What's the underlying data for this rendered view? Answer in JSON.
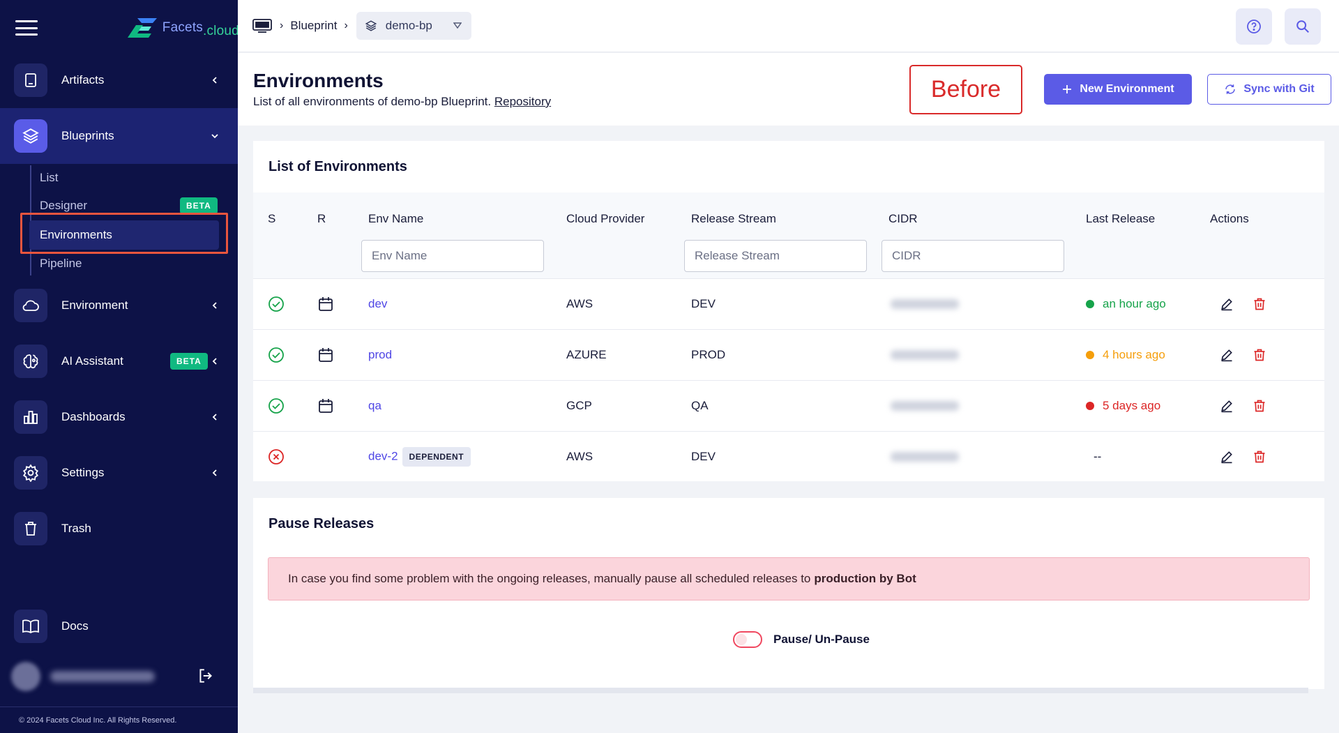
{
  "brand": {
    "name": "Facets",
    "suffix": ".cloud"
  },
  "sidebar": {
    "items": [
      {
        "label": "Artifacts",
        "icon": "book-icon"
      },
      {
        "label": "Blueprints",
        "icon": "layers-icon"
      },
      {
        "label": "Environment",
        "icon": "cloud-icon"
      },
      {
        "label": "AI Assistant",
        "icon": "brain-icon",
        "badge": "BETA"
      },
      {
        "label": "Dashboards",
        "icon": "bar-chart-icon"
      },
      {
        "label": "Settings",
        "icon": "gear-icon"
      },
      {
        "label": "Trash",
        "icon": "trash-icon"
      },
      {
        "label": "Docs",
        "icon": "open-book-icon"
      }
    ],
    "sub_items": [
      {
        "label": "List"
      },
      {
        "label": "Designer",
        "badge": "BETA"
      },
      {
        "label": "Environments"
      },
      {
        "label": "Pipeline"
      }
    ],
    "footer": "© 2024 Facets Cloud Inc. All Rights Reserved."
  },
  "topbar": {
    "crumb": "Blueprint",
    "selected_blueprint": "demo-bp"
  },
  "header": {
    "title": "Environments",
    "subtitle": "List of all environments of demo-bp Blueprint.",
    "repo_link": "Repository",
    "annotation": "Before",
    "new_env_button": "New Environment",
    "sync_button": "Sync with Git"
  },
  "environments": {
    "title": "List of Environments",
    "columns": {
      "s": "S",
      "r": "R",
      "env_name": "Env Name",
      "cloud": "Cloud Provider",
      "stream": "Release Stream",
      "cidr": "CIDR",
      "last_release": "Last Release",
      "actions": "Actions"
    },
    "filters": {
      "env_name": "Env Name",
      "stream": "Release Stream",
      "cidr": "CIDR"
    },
    "rows": [
      {
        "name": "dev",
        "cloud": "AWS",
        "stream": "DEV",
        "release": "an hour ago",
        "release_color": "#16a34a",
        "status": "ok",
        "badge": ""
      },
      {
        "name": "prod",
        "cloud": "AZURE",
        "stream": "PROD",
        "release": "4 hours ago",
        "release_color": "#f59e0b",
        "status": "ok",
        "badge": ""
      },
      {
        "name": "qa",
        "cloud": "GCP",
        "stream": "QA",
        "release": "5 days ago",
        "release_color": "#dc2626",
        "status": "ok",
        "badge": ""
      },
      {
        "name": "dev-2",
        "cloud": "AWS",
        "stream": "DEV",
        "release": "--",
        "release_color": "",
        "status": "error",
        "badge": "DEPENDENT"
      }
    ]
  },
  "pause": {
    "title": "Pause Releases",
    "alert_text": "In case you find some problem with the ongoing releases, manually pause all scheduled releases to",
    "alert_bold": "production by Bot",
    "toggle_label": "Pause/ Un-Pause"
  },
  "colors": {
    "sidebar_bg": "#0d1247",
    "accent": "#5b5be6",
    "link": "#4f46e5",
    "ok": "#16a34a",
    "error": "#dc2626"
  }
}
